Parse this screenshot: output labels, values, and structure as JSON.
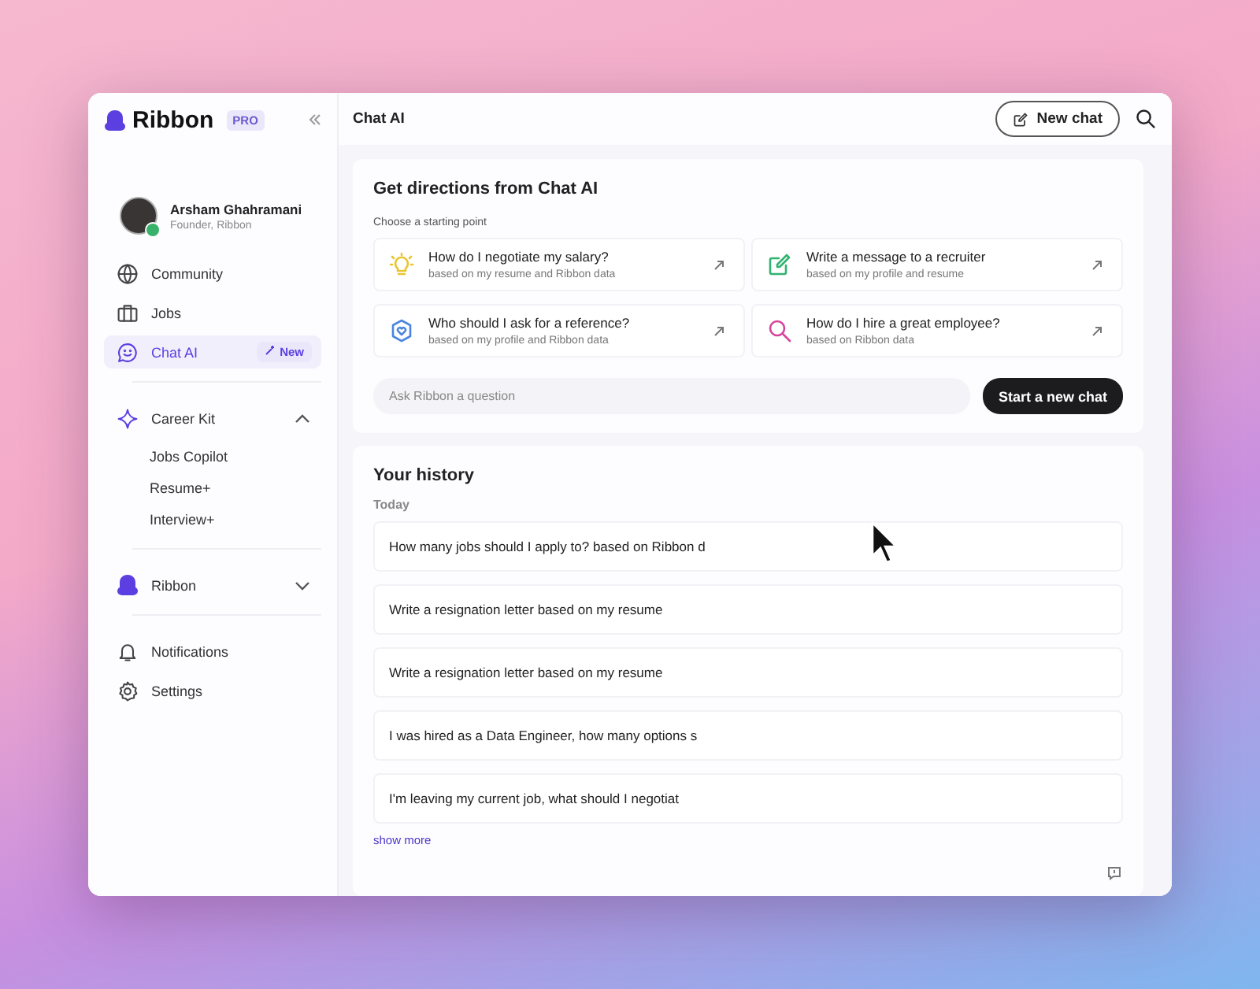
{
  "sidebar": {
    "brand": "Ribbon",
    "plan": "PRO",
    "user": {
      "name": "Arsham Ghahramani",
      "role": "Founder, Ribbon",
      "verified": true
    },
    "nav": [
      {
        "label": "Community",
        "selected": false
      },
      {
        "label": "Jobs",
        "selected": false
      },
      {
        "label": "Chat AI",
        "selected": true,
        "badge": "New"
      }
    ],
    "groups": [
      {
        "label": "Career Kit",
        "expanded": true,
        "children": [
          {
            "label": "Jobs Copilot"
          },
          {
            "label": "Resume+"
          },
          {
            "label": "Interview+"
          }
        ]
      },
      {
        "label": "Ribbon",
        "expanded": false
      }
    ],
    "footer_nav": [
      {
        "label": "Notifications"
      },
      {
        "label": "Settings"
      }
    ]
  },
  "header": {
    "title": "Chat AI",
    "new_chat_button": "New chat"
  },
  "directions": {
    "title": "Get directions from Chat AI",
    "subtitle": "Choose a starting point",
    "suggestions": [
      {
        "title": "How do I negotiate my salary?",
        "detail": "based on my resume and Ribbon data",
        "color": "#e8c531"
      },
      {
        "title": "Write a message to a recruiter",
        "detail": "based on my profile and resume",
        "color": "#2fb36f"
      },
      {
        "title": "Who should I ask for a reference?",
        "detail": "based on my profile and Ribbon data",
        "color": "#4a86e0"
      },
      {
        "title": "How do I hire a great employee?",
        "detail": "based on Ribbon data",
        "color": "#d6449a"
      }
    ],
    "question": {
      "placeholder": "Ask Ribbon a question"
    },
    "start_button": "Start a new chat"
  },
  "history": {
    "title": "Your history",
    "group": "Today",
    "items": [
      "How many jobs should I apply to? based on Ribbon d",
      "Write a resignation letter based on my resume",
      "Write a resignation letter based on my resume",
      "I was hired as a Data Engineer, how many options s",
      "I'm leaving my current job, what should I negotiat"
    ],
    "show_more": "show more"
  }
}
